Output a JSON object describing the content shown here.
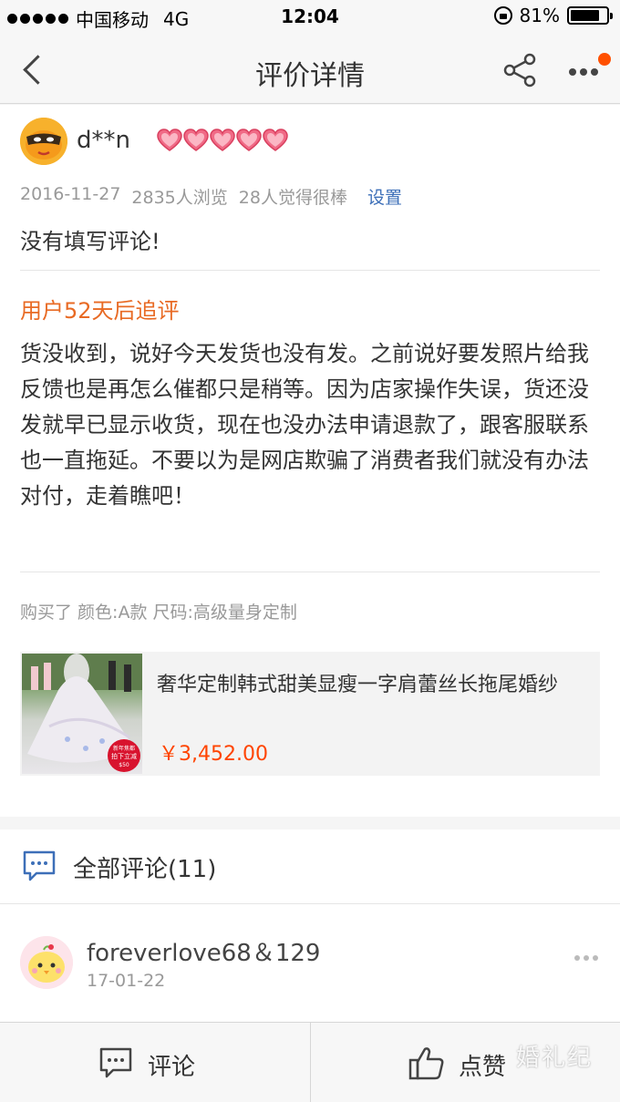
{
  "status_bar": {
    "carrier": "中国移动",
    "network": "4G",
    "time": "12:04",
    "battery_percent": "81%",
    "battery_level": 0.81
  },
  "nav": {
    "title": "评价详情",
    "back_icon": "back-chevron-icon",
    "share_icon": "share-icon",
    "more_icon": "more-dots-icon",
    "badge_color": "#ff5000"
  },
  "review": {
    "username": "d**n",
    "heart_count": 5,
    "date": "2016-11-27",
    "views": "2835人浏览",
    "likes": "28人觉得很棒",
    "settings_link": "设置",
    "content": "没有填写评论!",
    "followup_label": "用户52天后追评",
    "followup_text": "货没收到，说好今天发货也没有发。之前说好要发照片给我反馈也是再怎么催都只是稍等。因为店家操作失误，货还没发就早已显示收货，现在也没办法申请退款了，跟客服联系也一直拖延。不要以为是网店欺骗了消费者我们就没有办法对付，走着瞧吧！",
    "purchase_info": "购买了 颜色:A款 尺码:高级量身定制",
    "accent_color": "#e86a24"
  },
  "product": {
    "title": "奢华定制韩式甜美显瘦一字肩蕾丝长拖尾婚纱",
    "price": "￥3,452.00",
    "price_color": "#ff4400",
    "badge_text": "新年焦都",
    "badge_text2": "拍下立减",
    "badge_text3": "$50"
  },
  "comments": {
    "title": "全部评论(11)",
    "icon": "comment-bubble-icon",
    "items": [
      {
        "name": "foreverlove68＆129",
        "date": "17-01-22"
      }
    ]
  },
  "bottom_bar": {
    "comment_label": "评论",
    "like_label": "点赞",
    "comment_icon": "comment-icon",
    "like_icon": "thumbs-up-icon"
  },
  "watermark": "婚礼纪"
}
